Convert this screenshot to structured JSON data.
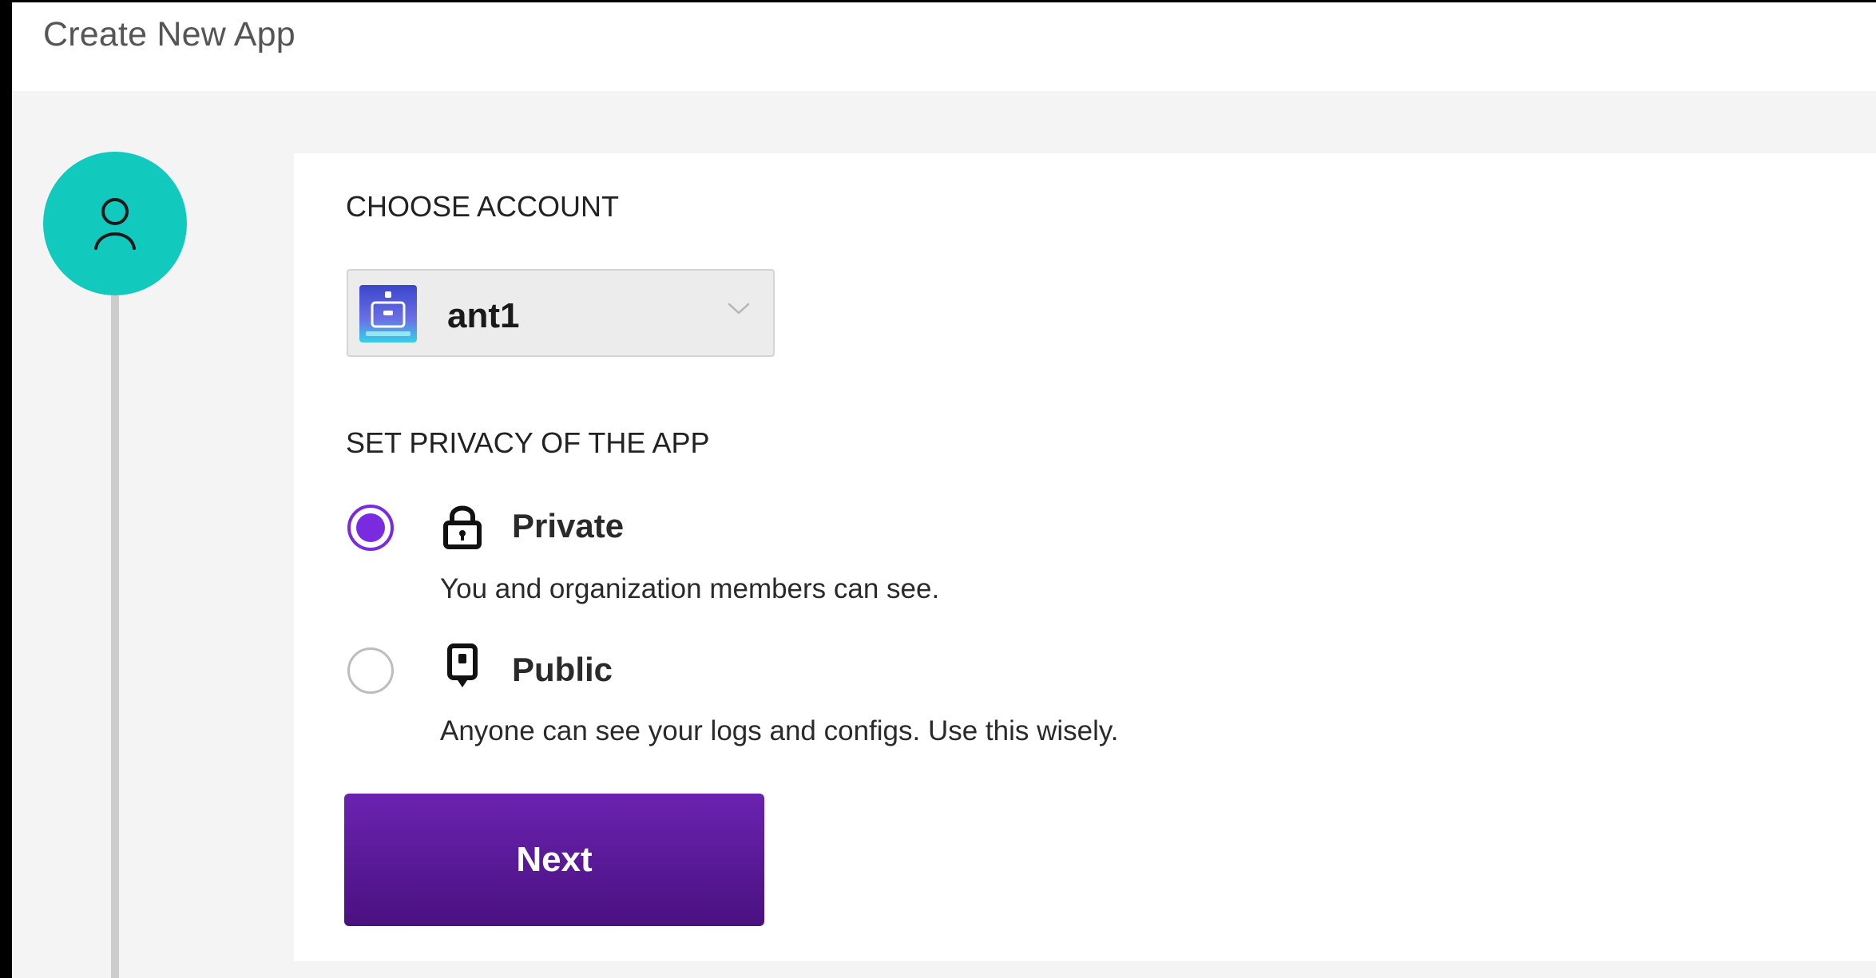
{
  "header": {
    "title": "Create New App"
  },
  "stepper": {
    "active_step_icon": "user-icon",
    "accent_color": "#12c9bd"
  },
  "form": {
    "account_section_label": "CHOOSE ACCOUNT",
    "account_select": {
      "selected_value": "ant1",
      "avatar_icon": "robot-avatar-icon",
      "chevron_icon": "chevron-down-icon"
    },
    "privacy_section_label": "SET PRIVACY OF THE APP",
    "privacy_options": [
      {
        "title": "Private",
        "description": "You and organization members can see.",
        "icon": "lock-icon",
        "selected": true
      },
      {
        "title": "Public",
        "description": "Anyone can see your logs and configs. Use this wisely.",
        "icon": "public-tag-icon",
        "selected": false
      }
    ],
    "next_label": "Next",
    "primary_color": "#5d1a9e",
    "radio_accent": "#7a2be0"
  }
}
